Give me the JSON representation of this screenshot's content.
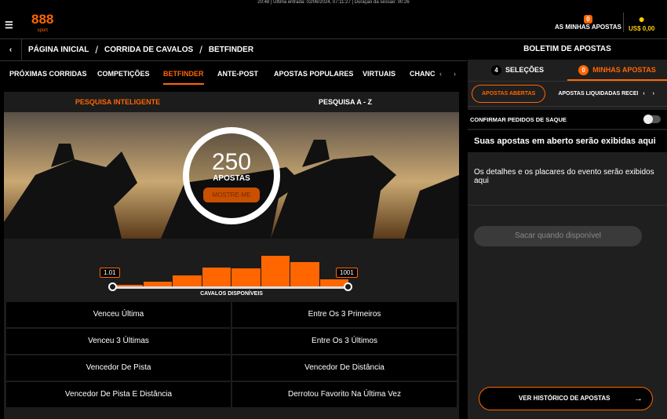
{
  "status_line": "20:48 | Última entrada: 02/06/2024, 07:11:27 | Duração da sessão: 00:26",
  "header": {
    "logo": "888",
    "logo_sub": "sport",
    "my_bets_count": "0",
    "my_bets_label": "AS MINHAS APOSTAS",
    "balance": "US$ 0,00"
  },
  "breadcrumb": [
    "PÁGINA INICIAL",
    "/",
    "CORRIDA DE CAVALOS",
    "/",
    "BETFINDER"
  ],
  "nav": [
    "PRÓXIMAS CORRIDAS",
    "COMPETIÇÕES",
    "BETFINDER",
    "ANTE-POST",
    "APOSTAS POPULARES",
    "VIRTUAIS",
    "CHANC"
  ],
  "search_tabs": [
    "PESQUISA INTELIGENTE",
    "PESQUISA A - Z"
  ],
  "hero": {
    "count": "250",
    "count_label": "APOSTAS",
    "button": "MOSTRE-ME"
  },
  "slider": {
    "min_label": "1.01",
    "max_label": "1001",
    "label": "CAVALOS DISPONÍVEIS",
    "histogram": [
      3,
      7,
      15,
      25,
      24,
      40,
      32,
      10
    ]
  },
  "filters": [
    [
      "Venceu Última",
      "Entre Os 3 Primeiros"
    ],
    [
      "Venceu 3 Últimas",
      "Entre Os 3 Últimos"
    ],
    [
      "Vencedor De Pista",
      "Vencedor De Distância"
    ],
    [
      "Vencedor De Pista E Distância",
      "Derrotou Favorito Na Última Vez"
    ]
  ],
  "betslip": {
    "title": "BOLETIM DE APOSTAS",
    "tab1_count": "4",
    "tab1": "SELEÇÕES",
    "tab2_count": "0",
    "tab2": "MINHAS APOSTAS",
    "filter1": "APOSTAS ABERTAS",
    "filter2": "APOSTAS LIQUIDADAS RECENT",
    "confirm": "CONFIRMAR PEDIDOS DE SAQUE",
    "empty": "Suas apostas em aberto serão exibidas aqui",
    "details": "Os detalhes e os placares do evento serão exibidos aqui",
    "cashout": "Sacar quando disponível",
    "history": "VER HISTÓRICO DE APOSTAS"
  }
}
